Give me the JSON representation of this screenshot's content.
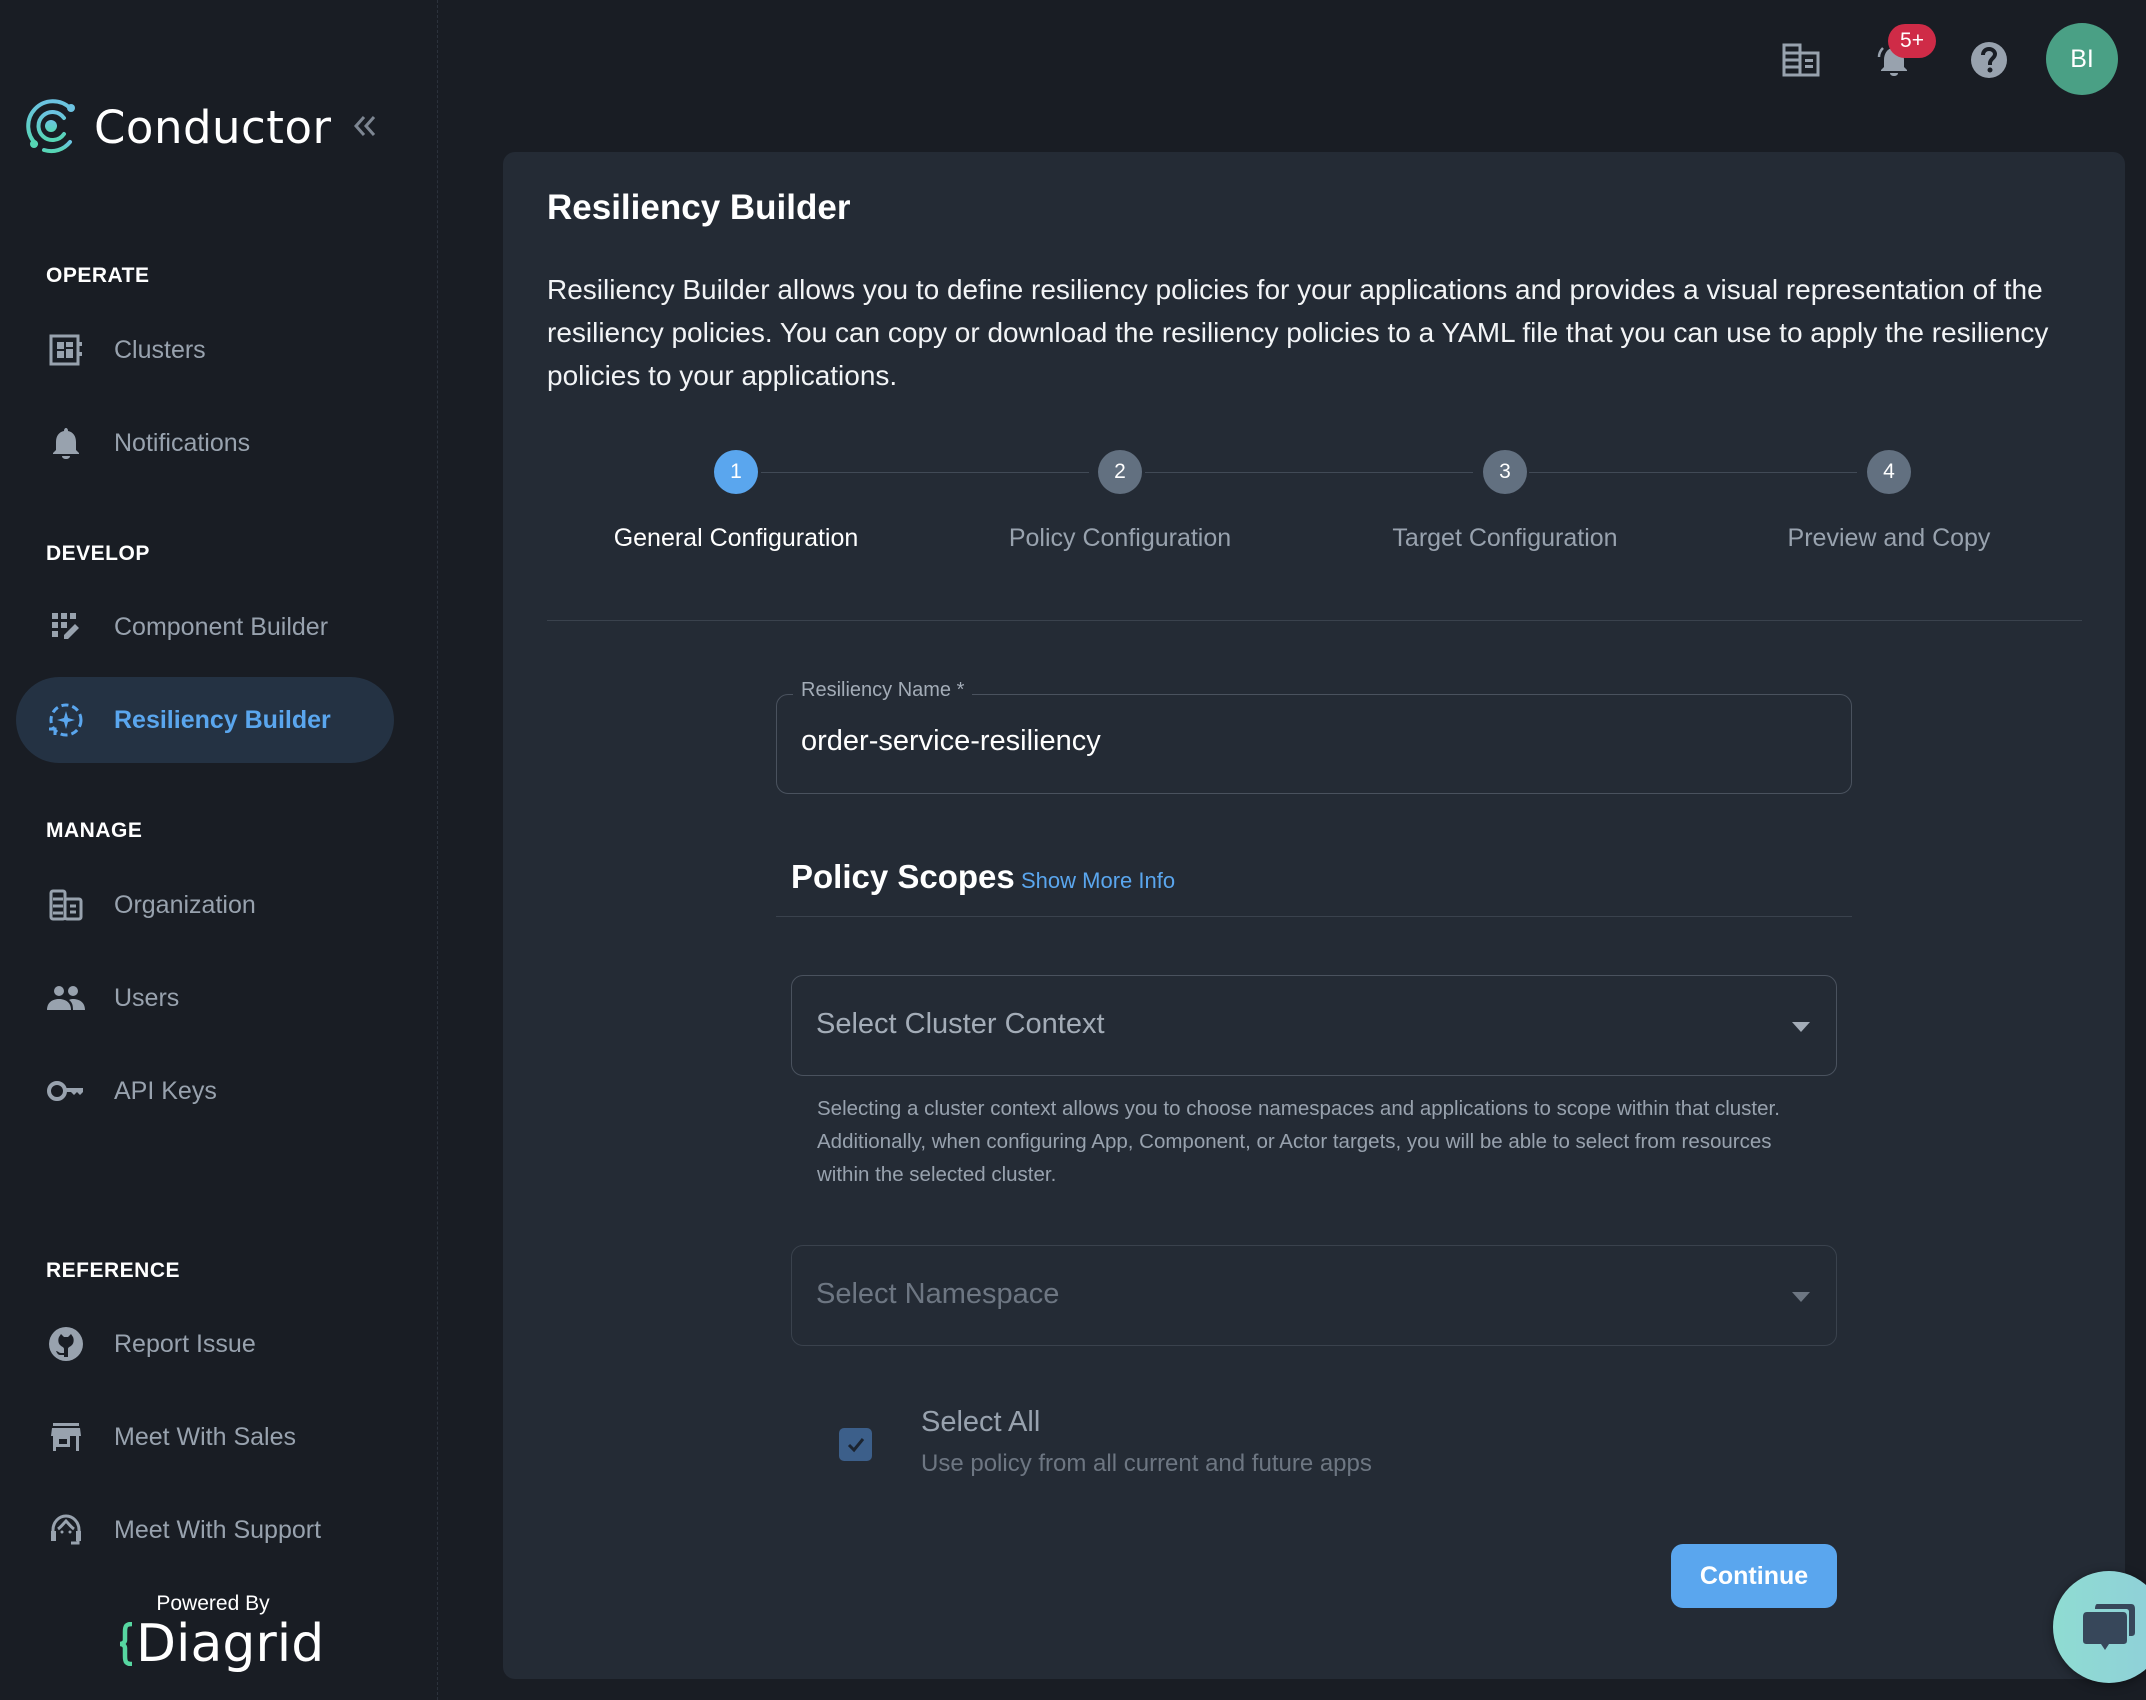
{
  "app": {
    "name": "Conductor",
    "collapse_label": "«"
  },
  "topbar": {
    "notification_badge": "5+",
    "avatar_initials": "BI",
    "icons": [
      "organization-icon",
      "bell-icon",
      "help-icon"
    ]
  },
  "sidebar": {
    "sections": [
      {
        "title": "OPERATE",
        "items": [
          {
            "label": "Clusters",
            "icon": "clusters-icon"
          },
          {
            "label": "Notifications",
            "icon": "bell-icon"
          }
        ]
      },
      {
        "title": "DEVELOP",
        "items": [
          {
            "label": "Component Builder",
            "icon": "component-builder-icon"
          },
          {
            "label": "Resiliency Builder",
            "icon": "resiliency-icon",
            "active": true
          }
        ]
      },
      {
        "title": "MANAGE",
        "items": [
          {
            "label": "Organization",
            "icon": "organization-icon"
          },
          {
            "label": "Users",
            "icon": "users-icon"
          },
          {
            "label": "API Keys",
            "icon": "key-icon"
          }
        ]
      },
      {
        "title": "REFERENCE",
        "items": [
          {
            "label": "Report Issue",
            "icon": "github-icon"
          },
          {
            "label": "Meet With Sales",
            "icon": "store-icon"
          },
          {
            "label": "Meet With Support",
            "icon": "support-agent-icon"
          }
        ]
      }
    ],
    "powered_by": "Powered By",
    "brand": "Diagrid"
  },
  "main": {
    "title": "Resiliency Builder",
    "description": "Resiliency Builder allows you to define resiliency policies for your applications and provides a visual representation of the resiliency policies. You can copy or download the resiliency policies to a YAML file that you can use to apply the resiliency policies to your applications.",
    "steps": [
      {
        "number": "1",
        "label": "General Configuration",
        "active": true
      },
      {
        "number": "2",
        "label": "Policy Configuration",
        "active": false
      },
      {
        "number": "3",
        "label": "Target Configuration",
        "active": false
      },
      {
        "number": "4",
        "label": "Preview and Copy",
        "active": false
      }
    ],
    "resiliency_name": {
      "label": "Resiliency Name *",
      "value": "order-service-resiliency"
    },
    "policy_scopes": {
      "title": "Policy Scopes",
      "show_more": "Show More Info",
      "cluster_select": {
        "placeholder": "Select Cluster Context",
        "helper": "Selecting a cluster context allows you to choose namespaces and applications to scope within that cluster. Additionally, when configuring App, Component, or Actor targets, you will be able to select from resources within the selected cluster."
      },
      "namespace_select": {
        "placeholder": "Select Namespace",
        "disabled": true
      },
      "select_all": {
        "label": "Select All",
        "description": "Use policy from all current and future apps",
        "checked": true
      }
    },
    "continue_label": "Continue"
  },
  "colors": {
    "accent": "#5aa6ee",
    "badge": "#cf2b47",
    "avatar": "#4aa085",
    "background": "#191d24",
    "card": "#242b35"
  }
}
